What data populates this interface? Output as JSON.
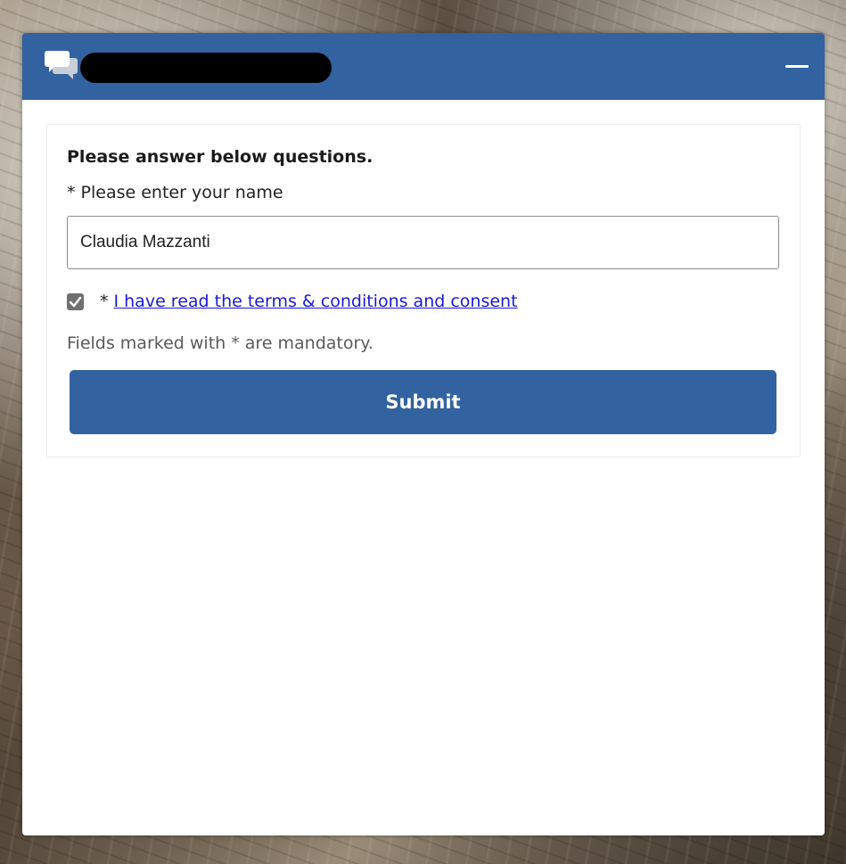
{
  "header": {
    "icon": "chat-bubbles-icon",
    "title_redacted": true,
    "minimize_icon": "minimize-icon",
    "color": "#3262a0"
  },
  "form": {
    "intro": "Please answer below questions.",
    "name_label": "* Please enter your name",
    "name_value": "Claudia Mazzanti",
    "consent_checked": true,
    "consent_asterisk": "*",
    "consent_link": "I have read the terms & conditions and consent",
    "mandatory_note": "Fields marked with * are mandatory.",
    "submit_label": "Submit"
  }
}
